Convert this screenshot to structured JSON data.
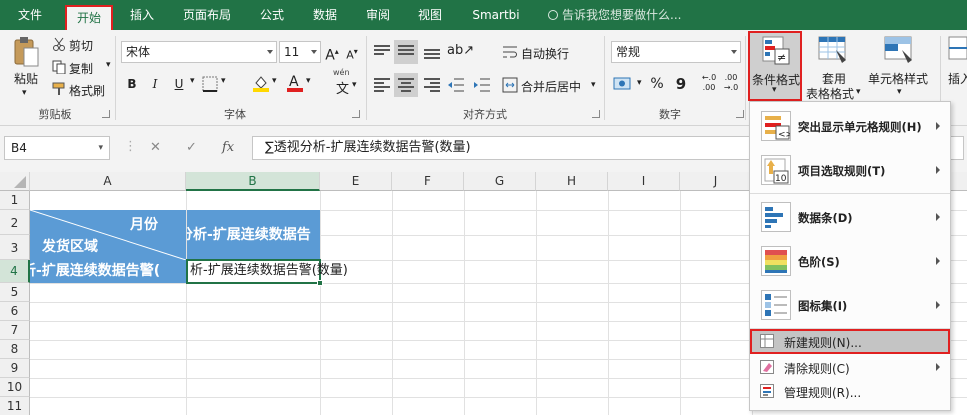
{
  "tabs": [
    "文件",
    "开始",
    "插入",
    "页面布局",
    "公式",
    "数据",
    "审阅",
    "视图",
    "Smartbi"
  ],
  "tell_me": "告诉我您想要做什么...",
  "ribbon": {
    "clipboard": {
      "paste": "粘贴",
      "cut": "剪切",
      "copy": "复制",
      "format_painter": "格式刷",
      "label": "剪贴板"
    },
    "font": {
      "name": "宋体",
      "size": "11",
      "bold": "B",
      "italic": "I",
      "underline": "U",
      "label": "字体",
      "wen": "wén",
      "wen_char": "文"
    },
    "alignment": {
      "wrap": "自动换行",
      "merge": "合并后居中",
      "label": "对齐方式"
    },
    "number": {
      "format": "常规",
      "percent": "%",
      "comma": "9",
      "label": "数字"
    },
    "styles": {
      "conditional": "条件格式",
      "table_line1": "套用",
      "table_line2": "表格格式",
      "cell_styles": "单元格样式"
    },
    "cells": {
      "insert": "插入"
    }
  },
  "formula_bar": {
    "name_box": "B4",
    "cancel": "✕",
    "enter": "✓",
    "fx": "fx",
    "formula": "∑透视分析-扩展连续数据告警(数量)"
  },
  "columns": [
    "A",
    "B",
    "E",
    "F",
    "G",
    "H",
    "I",
    "J"
  ],
  "rows": [
    "1",
    "2",
    "3",
    "4",
    "5",
    "6",
    "7",
    "8",
    "9",
    "10",
    "11"
  ],
  "cells": {
    "corner_top": "月份",
    "corner_bottom": "发货区域",
    "b23": "分析-扩展连续数据告",
    "a4": "析-扩展连续数据告警(",
    "b4": "析-扩展连续数据告警(数量)"
  },
  "menu": {
    "highlight_rules": "突出显示单元格规则(H)",
    "top_bottom": "项目选取规则(T)",
    "data_bars": "数据条(D)",
    "color_scales": "色阶(S)",
    "icon_sets": "图标集(I)",
    "new_rule": "新建规则(N)...",
    "clear_rules": "清除规则(C)",
    "manage_rules": "管理规则(R)..."
  },
  "colors": {
    "excel_green": "#217346",
    "header_blue": "#5b9bd5",
    "highlight_red": "#e02020"
  }
}
